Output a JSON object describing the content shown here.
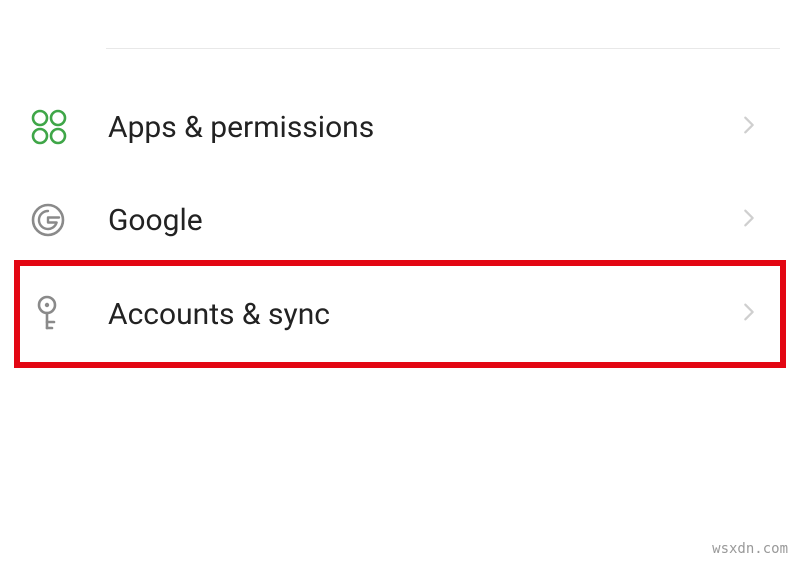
{
  "settings": {
    "items": [
      {
        "label": "Apps & permissions"
      },
      {
        "label": "Google"
      },
      {
        "label": "Accounts & sync"
      }
    ]
  },
  "watermark": "wsxdn.com",
  "colors": {
    "highlight_border": "#E30613",
    "apps_icon": "#3FA648",
    "muted_icon": "#8A8A8A",
    "chevron": "#CFCFCF",
    "text": "#222222"
  }
}
